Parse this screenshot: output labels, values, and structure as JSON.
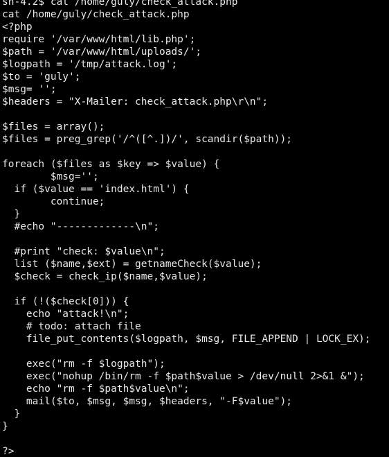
{
  "terminal": {
    "colors": {
      "background": "#000000",
      "foreground": "#e8e8e8"
    },
    "lines": [
      "sh-4.2$ cat /home/guly/check_attack.php",
      "cat /home/guly/check_attack.php",
      "<?php",
      "require '/var/www/html/lib.php';",
      "$path = '/var/www/html/uploads/';",
      "$logpath = '/tmp/attack.log';",
      "$to = 'guly';",
      "$msg= '';",
      "$headers = \"X-Mailer: check_attack.php\\r\\n\";",
      "",
      "$files = array();",
      "$files = preg_grep('/^([^.])/', scandir($path));",
      "",
      "foreach ($files as $key => $value) {",
      "        $msg='';",
      "  if ($value == 'index.html') {",
      "        continue;",
      "  }",
      "  #echo \"-------------\\n\";",
      "",
      "  #print \"check: $value\\n\";",
      "  list ($name,$ext) = getnameCheck($value);",
      "  $check = check_ip($name,$value);",
      "",
      "  if (!($check[0])) {",
      "    echo \"attack!\\n\";",
      "    # todo: attach file",
      "    file_put_contents($logpath, $msg, FILE_APPEND | LOCK_EX);",
      "",
      "    exec(\"rm -f $logpath\");",
      "    exec(\"nohup /bin/rm -f $path$value > /dev/null 2>&1 &\");",
      "    echo \"rm -f $path$value\\n\";",
      "    mail($to, $msg, $msg, $headers, \"-F$value\");",
      "  }",
      "}",
      "",
      "?>"
    ]
  }
}
